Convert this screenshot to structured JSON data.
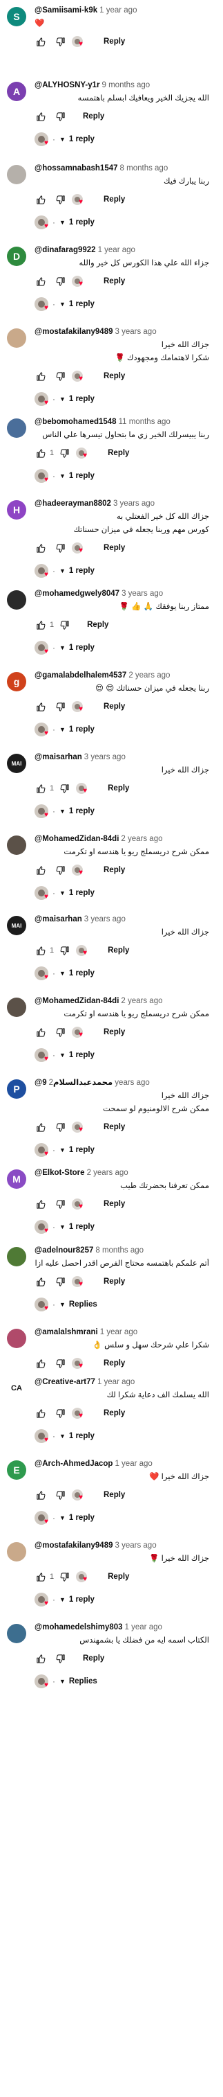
{
  "labels": {
    "reply": "Reply",
    "one_reply": "1 reply",
    "replies": "Replies"
  },
  "colors": {
    "heart": "#ff0033",
    "link_text": "#0f0f0f",
    "muted": "#606060"
  },
  "comments": [
    {
      "author": "@Samiisami-k9k",
      "time": "1 year ago",
      "text": "❤️",
      "avatar_letter": "S",
      "avatar_color": "#0e8a7d",
      "likes": "",
      "creator_heart": true,
      "replies": ""
    },
    {
      "author": "@ALYHOSNY-y1r",
      "time": "9 months ago",
      "text": "الله يجزيك الخير ويعافيك ابسلم باهتمسه",
      "avatar_letter": "A",
      "avatar_color": "#7b3fb0",
      "likes": "",
      "creator_heart": false,
      "replies": "1 reply"
    },
    {
      "author": "@hossamnabash1547",
      "time": "8 months ago",
      "text": "ربنا يبارك فيك",
      "avatar_letter": "",
      "avatar_color": "#b5b0aa",
      "likes": "",
      "creator_heart": true,
      "replies": "1 reply"
    },
    {
      "author": "@dinafarag9922",
      "time": "1 year ago",
      "text": "جزاء الله علي هذا الكورس كل خير والله",
      "avatar_letter": "D",
      "avatar_color": "#2e8b3e",
      "likes": "",
      "creator_heart": true,
      "replies": "1 reply"
    },
    {
      "author": "@mostafakilany9489",
      "time": "3 years ago",
      "text": "جزاك الله خيرا",
      "text2": "شكرا لاهتمامك ومجهودك 🌹",
      "avatar_letter": "",
      "avatar_color": "#c9a98a",
      "likes": "",
      "creator_heart": true,
      "replies": "1 reply"
    },
    {
      "author": "@bebomohamed1548",
      "time": "11 months ago",
      "text": "ربنا يبيسرلك الخير زي ما بتحاول تيسرها علي الناس",
      "avatar_letter": "",
      "avatar_color": "#4a6e9a",
      "likes": "1",
      "creator_heart": true,
      "replies": "1 reply"
    },
    {
      "author": "@hadeerayman8802",
      "time": "3 years ago",
      "text": "جزاك الله كل خير الفعتلي به",
      "text2": "كورس مهم وربنا يجعله في ميزان حسناتك",
      "avatar_letter": "H",
      "avatar_color": "#8e44c4",
      "likes": "",
      "creator_heart": true,
      "replies": "1 reply"
    },
    {
      "author": "@mohamedgwely8047",
      "time": "3 years ago",
      "text": "ممتاز ربنا يوفقك 🙏 👍 🌹",
      "avatar_letter": "",
      "avatar_color": "#2a2a2a",
      "likes": "1",
      "creator_heart": false,
      "replies": "1 reply"
    },
    {
      "author": "@gamalabdelhalem4537",
      "time": "2 years ago",
      "text": "ربنا يجعله في ميزان حسناتك 😍 😍",
      "avatar_letter": "g",
      "avatar_color": "#d0421b",
      "likes": "",
      "creator_heart": true,
      "replies": "1 reply"
    },
    {
      "author": "@maisarhan",
      "time": "3 years ago",
      "text": "جزاك الله خيرا",
      "avatar_letter": "MAI",
      "avatar_color": "#1c1c1c",
      "likes": "1",
      "creator_heart": true,
      "replies": "1 reply"
    },
    {
      "author": "@MohamedZidan-84di",
      "time": "2 years ago",
      "text": "ممكن شرح دريسملج ريو يا هندسه او تكرمت",
      "avatar_letter": "",
      "avatar_color": "#5b5148",
      "likes": "",
      "creator_heart": true,
      "replies": "1 reply"
    },
    {
      "author": "@maisarhan",
      "time": "3 years ago",
      "text": "جزاك الله خيرا",
      "avatar_letter": "MAI",
      "avatar_color": "#1c1c1c",
      "likes": "1",
      "creator_heart": true,
      "replies": "1 reply"
    },
    {
      "author": "@MohamedZidan-84di",
      "time": "2 years ago",
      "text": "ممكن شرح دريسملج ريو يا هندسه او تكرمت",
      "avatar_letter": "",
      "avatar_color": "#5b5148",
      "likes": "",
      "creator_heart": true,
      "replies": "1 reply"
    },
    {
      "author": "@محمدعبدالسلام9",
      "time": "2 years ago",
      "text": "جزاك الله خيرا",
      "text2": "ممكن شرح الالومنيوم لو سمحت",
      "avatar_letter": "P",
      "avatar_color": "#1e4fa0",
      "likes": "",
      "creator_heart": true,
      "replies": "1 reply"
    },
    {
      "author": "@Elkot-Store",
      "time": "2 years ago",
      "text": "ممكن تعرفنا بحضرتك طيب",
      "avatar_letter": "M",
      "avatar_color": "#8a4bc4",
      "likes": "",
      "creator_heart": true,
      "replies": "1 reply"
    },
    {
      "author": "@adelnour8257",
      "time": "8 months ago",
      "text": "أتم علمكم باهتمسه محتاج الفرص اقدر احصل عليه ازاي",
      "avatar_letter": "",
      "avatar_color": "#4f7a35",
      "likes": "",
      "creator_heart": true,
      "replies": "Replies"
    },
    {
      "author": "@amalalshmrani",
      "time": "1 year ago",
      "text": "شكرا علي شرحك سهل و سلس 👌",
      "avatar_letter": "",
      "avatar_color": "#b04a6a",
      "likes": "",
      "creator_heart": true,
      "replies": ""
    },
    {
      "author": "@Creative-art77",
      "time": "1 year ago",
      "text": "الله يسلمك الف دعاية شكرا لك",
      "avatar_letter": "CA",
      "avatar_color": "#ffffff",
      "likes": "",
      "creator_heart": true,
      "replies": "1 reply"
    },
    {
      "author": "@Arch-AhmedJacop",
      "time": "1 year ago",
      "text": "جزاك الله خيرا ❤️",
      "avatar_letter": "E",
      "avatar_color": "#2e9a4e",
      "likes": "",
      "creator_heart": true,
      "replies": "1 reply"
    },
    {
      "author": "@mostafakilany9489",
      "time": "3 years ago",
      "text": "جزاك الله خيرا 🌹",
      "avatar_letter": "",
      "avatar_color": "#c9a98a",
      "likes": "1",
      "creator_heart": true,
      "replies": "1 reply"
    },
    {
      "author": "@mohamedelshimy803",
      "time": "1 year ago",
      "text": "الكتاب اسمه ايه من فضلك يا بشمهندس",
      "avatar_letter": "",
      "avatar_color": "#3d6e8f",
      "likes": "",
      "creator_heart": false,
      "replies": "Replies"
    }
  ]
}
